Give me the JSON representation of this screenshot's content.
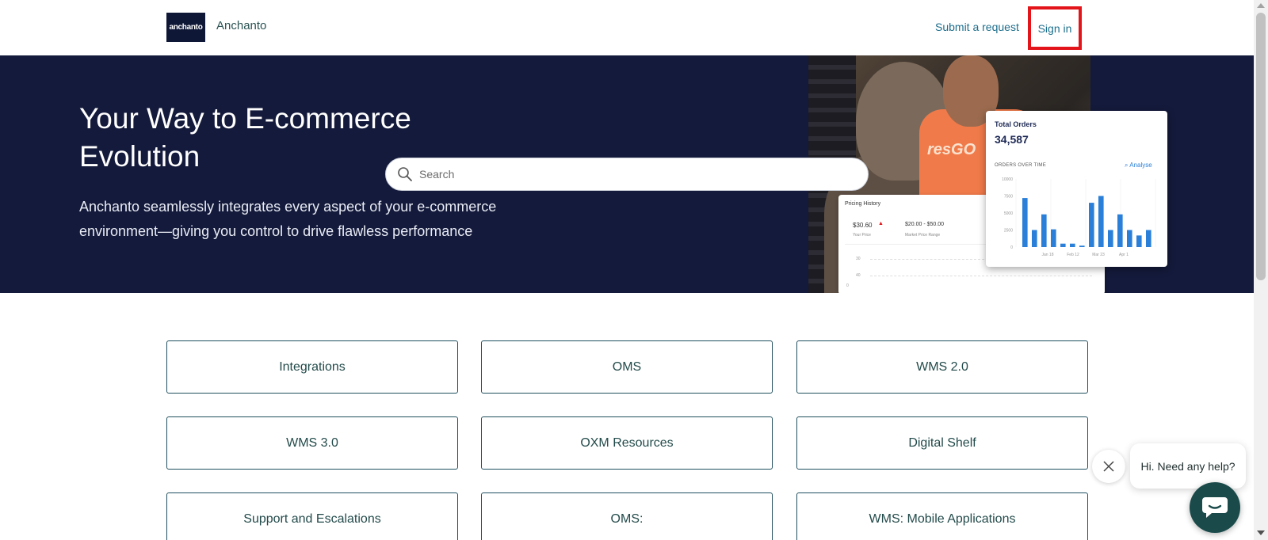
{
  "header": {
    "logo_text": "anchanto",
    "brand_name": "Anchanto",
    "nav": {
      "submit_request": "Submit a request",
      "sign_in": "Sign in"
    }
  },
  "hero": {
    "title": "Your Way to E-commerce Evolution",
    "description": "Anchanto seamlessly integrates every aspect of your e-commerce environment—giving you control to drive flawless performance",
    "search_placeholder": "Search",
    "illustration": {
      "shirt_text": "resGO",
      "pricing_card": {
        "title": "Pricing History",
        "price": "$30.60",
        "price_label": "Your Price",
        "range": "$20.00 - $50.00",
        "range_label": "Market Price Range",
        "axis": [
          "30",
          "40",
          "0"
        ]
      },
      "orders_card": {
        "title": "Total Orders",
        "value": "34,587",
        "subtitle": "ORDERS OVER TIME",
        "analyse_label": "Analyse",
        "y_ticks": [
          "10000",
          "7500",
          "5000",
          "2500",
          "0"
        ],
        "x_ticks": [
          "Jan 18",
          "Feb 12",
          "Mar 23",
          "Apr 1"
        ],
        "bar_color": "#2a7fd8"
      }
    }
  },
  "categories": [
    "Integrations",
    "OMS",
    "WMS 2.0",
    "WMS 3.0",
    "OXM Resources",
    "Digital Shelf",
    "Support and Escalations",
    "OMS:",
    "WMS: Mobile Applications"
  ],
  "chat": {
    "greeting": "Hi. Need any help?"
  },
  "colors": {
    "hero_bg": "#141a3b",
    "link": "#1d6e8c",
    "highlight_border": "#e3151b",
    "chat_button": "#1a4a4a"
  }
}
